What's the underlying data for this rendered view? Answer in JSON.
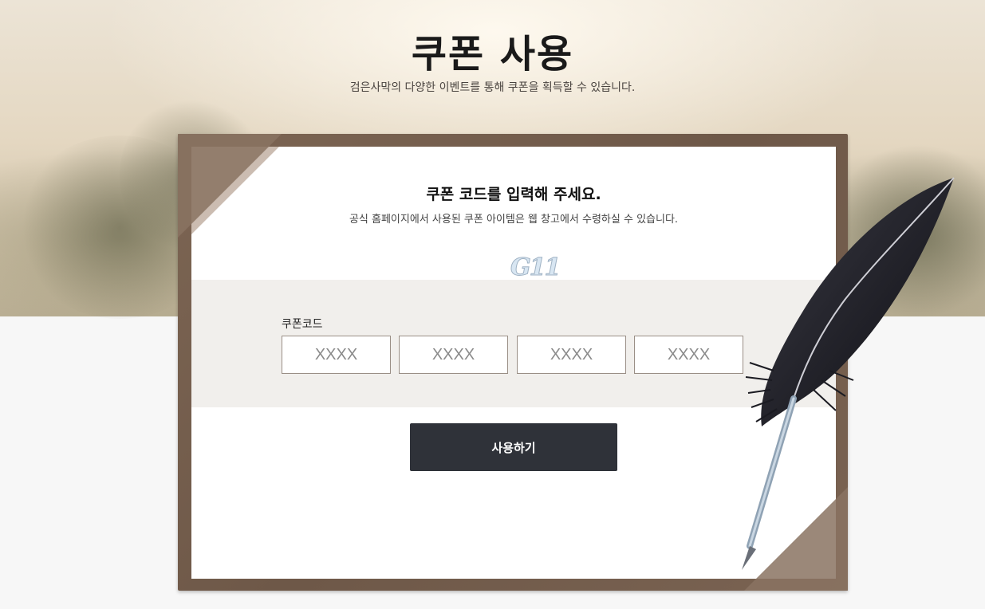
{
  "header": {
    "title": "쿠폰 사용",
    "subtitle": "검은사막의 다양한 이벤트를 통해 쿠폰을 획득할 수 있습니다."
  },
  "form": {
    "title": "쿠폰 코드를 입력해 주세요.",
    "description": "공식 홈페이지에서 사용된 쿠폰 아이템은 웹 창고에서 수령하실 수 있습니다.",
    "coupon_label": "쿠폰코드",
    "code_fields": [
      {
        "placeholder": "XXXX",
        "value": ""
      },
      {
        "placeholder": "XXXX",
        "value": ""
      },
      {
        "placeholder": "XXXX",
        "value": ""
      },
      {
        "placeholder": "XXXX",
        "value": ""
      }
    ],
    "submit_label": "사용하기"
  },
  "watermark": {
    "text": "G11"
  },
  "colors": {
    "frame": "#6e5848",
    "button_bg": "#2f3239",
    "band_bg": "#f1efec"
  },
  "icons": {
    "quill": "quill-pen-icon"
  }
}
